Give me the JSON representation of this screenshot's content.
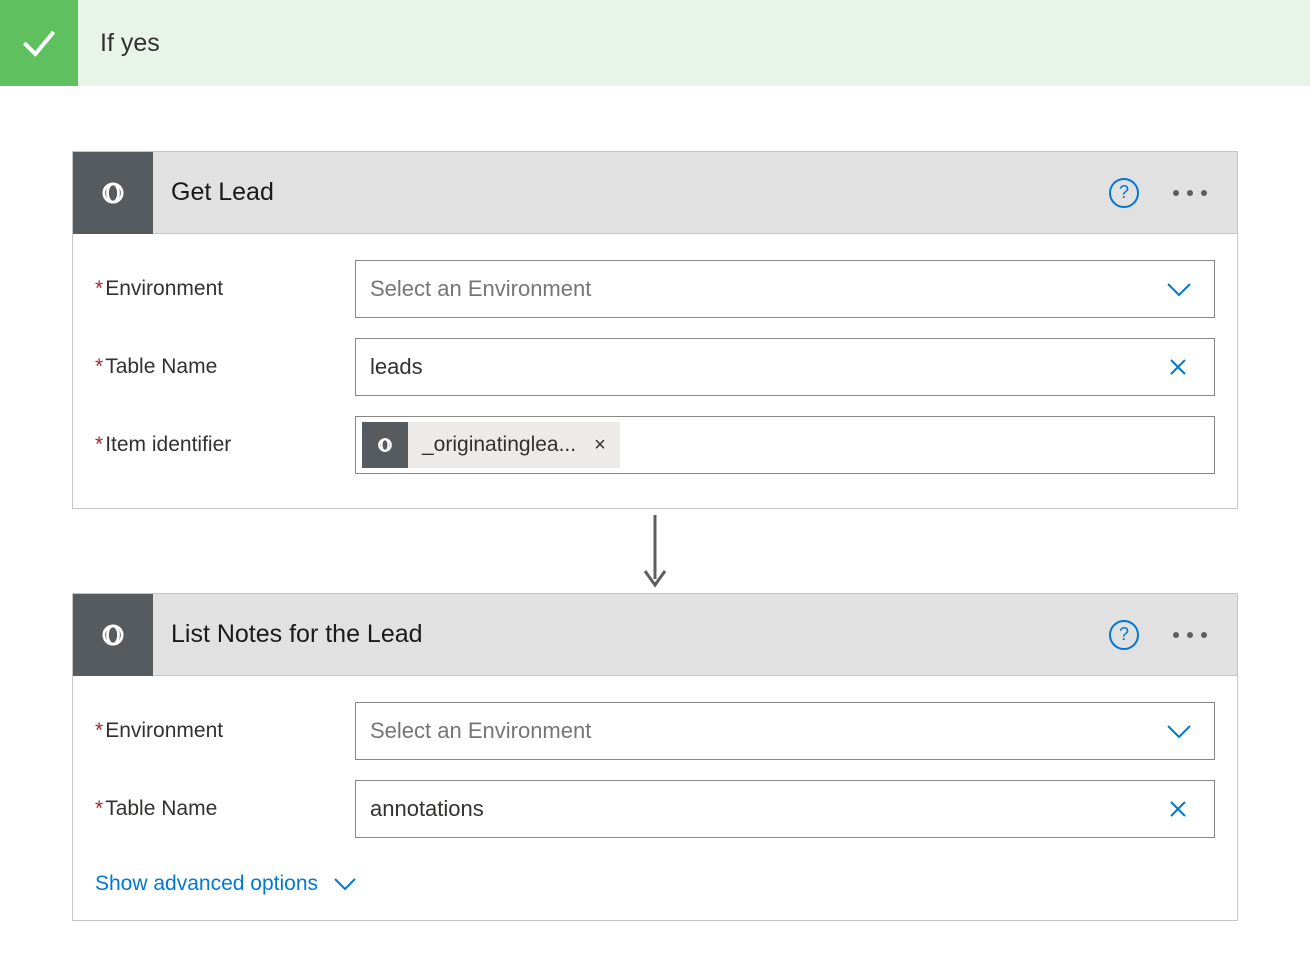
{
  "branch": {
    "title": "If yes"
  },
  "actions": [
    {
      "title": "Get Lead",
      "fields": {
        "environment": {
          "label": "Environment",
          "placeholder": "Select an Environment"
        },
        "table": {
          "label": "Table Name",
          "value": "leads"
        },
        "identifier": {
          "label": "Item identifier",
          "token": "_originatinglea..."
        }
      }
    },
    {
      "title": "List Notes for the Lead",
      "fields": {
        "environment": {
          "label": "Environment",
          "placeholder": "Select an Environment"
        },
        "table": {
          "label": "Table Name",
          "value": "annotations"
        }
      },
      "advanced_label": "Show advanced options"
    }
  ]
}
